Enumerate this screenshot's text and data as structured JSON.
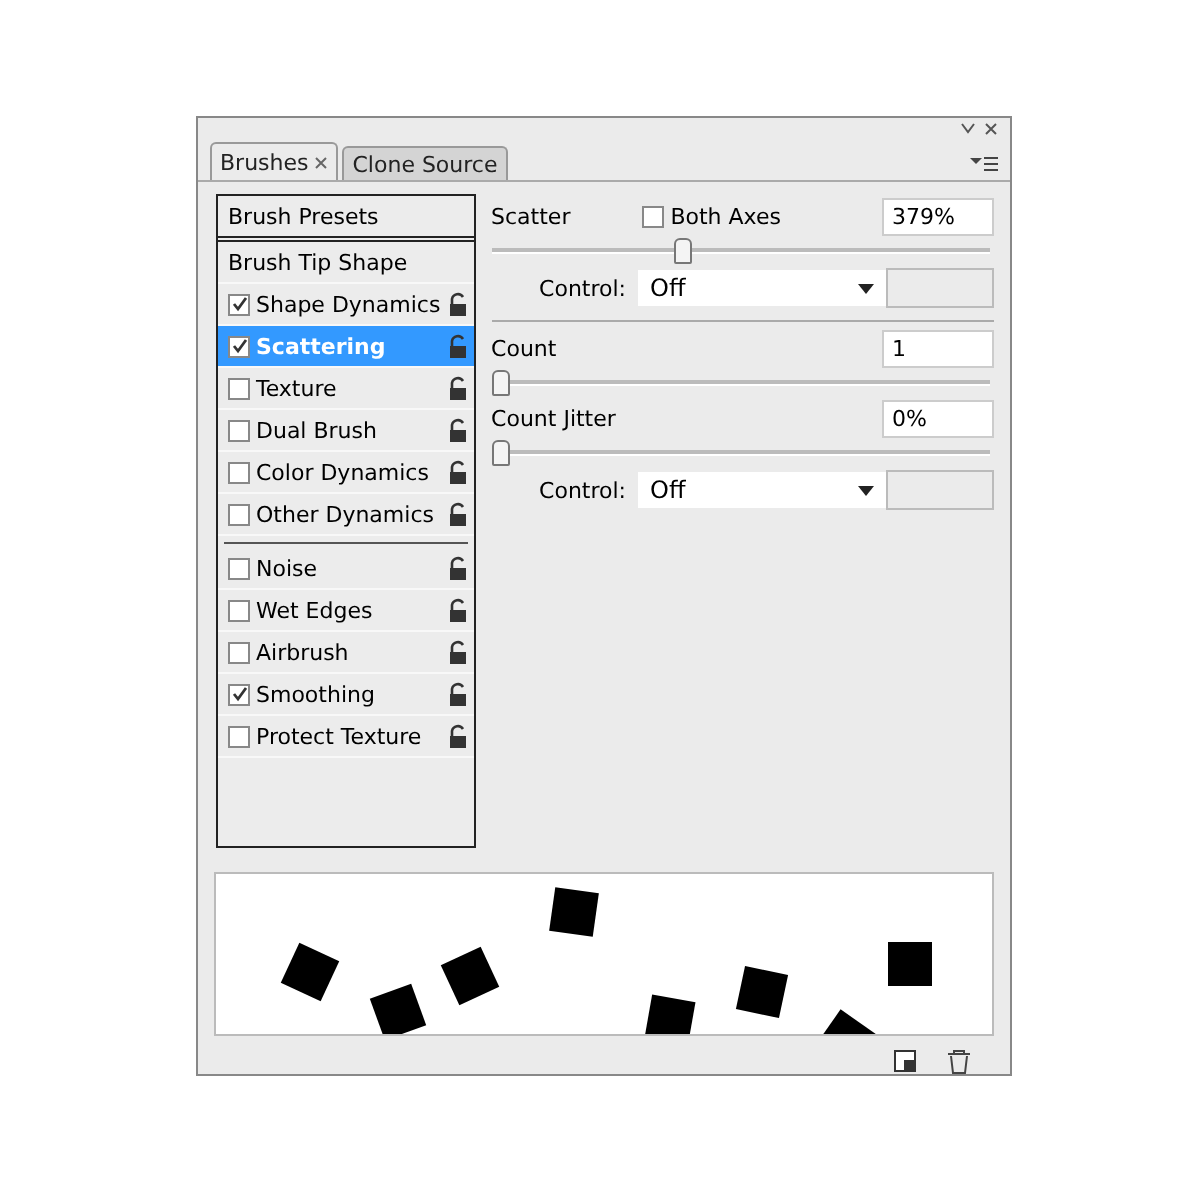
{
  "tabs": [
    {
      "label": "Brushes",
      "selected": true,
      "closable": true
    },
    {
      "label": "Clone Source",
      "selected": false,
      "closable": false
    }
  ],
  "sidebar": {
    "header": "Brush Presets",
    "sections": [
      [
        {
          "kind": "plain",
          "label": "Brush Tip Shape",
          "selected": false
        },
        {
          "kind": "check",
          "label": "Shape Dynamics",
          "checked": true,
          "selected": false
        },
        {
          "kind": "check",
          "label": "Scattering",
          "checked": true,
          "selected": true
        },
        {
          "kind": "check",
          "label": "Texture",
          "checked": false,
          "selected": false
        },
        {
          "kind": "check",
          "label": "Dual Brush",
          "checked": false,
          "selected": false
        },
        {
          "kind": "check",
          "label": "Color Dynamics",
          "checked": false,
          "selected": false
        },
        {
          "kind": "check",
          "label": "Other Dynamics",
          "checked": false,
          "selected": false
        }
      ],
      [
        {
          "kind": "check",
          "label": "Noise",
          "checked": false,
          "selected": false
        },
        {
          "kind": "check",
          "label": "Wet Edges",
          "checked": false,
          "selected": false
        },
        {
          "kind": "check",
          "label": "Airbrush",
          "checked": false,
          "selected": false
        },
        {
          "kind": "check",
          "label": "Smoothing",
          "checked": true,
          "selected": false
        },
        {
          "kind": "check",
          "label": "Protect Texture",
          "checked": false,
          "selected": false
        }
      ]
    ]
  },
  "settings": [
    {
      "kind": "slider",
      "label": "Scatter",
      "option": {
        "label": "Both Axes",
        "checked": false
      },
      "value": "379%",
      "level": 0.38
    },
    {
      "kind": "control",
      "label": "Control:",
      "value": "Off",
      "divider": true
    },
    {
      "kind": "slider",
      "label": "Count",
      "value": "1",
      "level": 0
    },
    {
      "kind": "slider",
      "label": "Count Jitter",
      "value": "0%",
      "level": 0
    },
    {
      "kind": "control",
      "label": "Control:",
      "value": "Off",
      "divider": false
    }
  ]
}
